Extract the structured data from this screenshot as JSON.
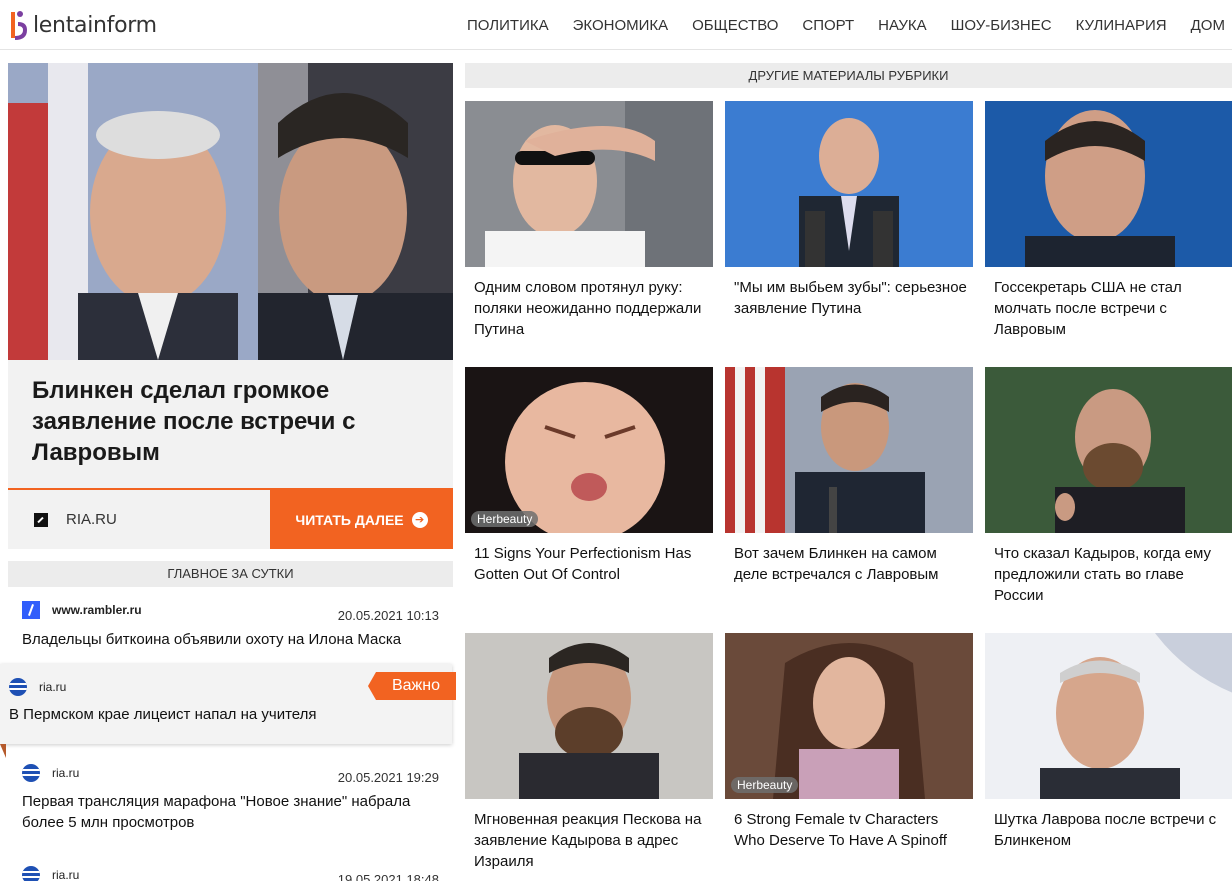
{
  "header": {
    "logo_text": "lentainform",
    "nav": [
      "ПОЛИТИКА",
      "ЭКОНОМИКА",
      "ОБЩЕСТВО",
      "СПОРТ",
      "НАУКА",
      "ШОУ-БИЗНЕС",
      "КУЛИНАРИЯ",
      "ДОМ"
    ]
  },
  "hero": {
    "title": "Блинкен сделал громкое заявление после встречи с Лавровым",
    "source": "RIA.RU",
    "read_more": "ЧИТАТЬ ДАЛЕЕ"
  },
  "main_news": {
    "heading": "ГЛАВНОЕ ЗА СУТКИ",
    "items": [
      {
        "source": "www.rambler.ru",
        "date": "20.05.2021 10:13",
        "title": "Владельцы биткоина объявили охоту на Илона Маска"
      },
      {
        "source": "ria.ru",
        "badge": "Важно",
        "title": "В Пермском крае лицеист напал на учителя"
      },
      {
        "source": "ria.ru",
        "date": "20.05.2021 19:29",
        "title": "Первая трансляция марафона \"Новое знание\" набрала более 5 млн просмотров"
      },
      {
        "source": "ria.ru",
        "date": "19.05.2021 18:48"
      }
    ]
  },
  "related": {
    "heading": "ДРУГИЕ МАТЕРИАЛЫ РУБРИКИ",
    "cards": [
      {
        "title": "Одним словом протянул руку: поляки неожиданно поддержали Путина"
      },
      {
        "title": "\"Мы им выбьем зубы\": серьезное заявление Путина"
      },
      {
        "title": "Госсекретарь США не стал молчать после встречи с Лавровым"
      },
      {
        "title": "11 Signs Your Perfectionism Has Gotten Out Of Control",
        "tag": "Herbeauty"
      },
      {
        "title": "Вот зачем Блинкен на самом деле встречался с Лавровым"
      },
      {
        "title": "Что сказал Кадыров, когда ему предложили стать во главе России"
      },
      {
        "title": "Мгновенная реакция Пескова на заявление Кадырова в адрес Израиля"
      },
      {
        "title": "6 Strong Female tv Characters Who Deserve To Have A Spinoff",
        "tag": "Herbeauty"
      },
      {
        "title": "Шутка Лаврова после встречи с Блинкеном"
      }
    ]
  },
  "colors": {
    "accent": "#f26321",
    "gray_bar": "#ececec",
    "panel": "#f2f2f2"
  }
}
